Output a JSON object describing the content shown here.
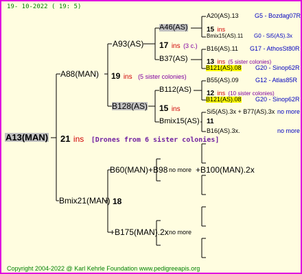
{
  "header": {
    "date": "19- 10-2022 ( 19: 5)"
  },
  "footer": {
    "copyright": "Copyright 2004-2022 @ Karl Kehrle Foundation    www.pedigreeapis.org"
  },
  "root": {
    "name": "A13(MAN)",
    "ins": "21",
    "ins_label": "ins",
    "note": "[Drones from 6 sister colonies]"
  },
  "gen1": {
    "top": {
      "name": "A88(MAN)",
      "ins": "19",
      "ins_label": "ins",
      "note": "(5 sister colonies)"
    },
    "bottom": {
      "name": "Bmix21(MAN)",
      "ins": "18"
    }
  },
  "gen2": {
    "a93": {
      "name": "A93(AS)",
      "ins": "17",
      "ins_label": "ins",
      "note": "(3 c.)"
    },
    "b128": {
      "name": "B128(AS)",
      "ins": "15",
      "ins_label": "ins"
    },
    "b60": {
      "name": "B60(MAN)+B98",
      "more": "no more"
    },
    "b175": {
      "name": "+B175(MAN).2x",
      "more": "no more"
    },
    "b100": {
      "name": "+B100(MAN).2x"
    }
  },
  "gen3": {
    "a46": {
      "name": "A46(AS)"
    },
    "b37": {
      "name": "B37(AS)"
    },
    "b112": {
      "name": "B112(AS)"
    },
    "bmix15": {
      "name": "Bmix15(AS)"
    }
  },
  "gen4": {
    "g1": {
      "name": "A20(AS).13",
      "loc": "G5 - Bozdag07R",
      "ins": "15",
      "ins_label": "ins",
      "extra": "Bmix15(AS).11",
      "extra_loc": "G0 - Si5(AS).3x"
    },
    "g2": {
      "name": "B16(AS).11",
      "loc": "G17 - AthosSt80R",
      "ins": "13",
      "ins_label": "ins",
      "note": "(5 sister colonies)",
      "extra": "B121(AS).08",
      "extra_loc": "G20 - Sinop62R"
    },
    "g3": {
      "name": "B55(AS).09",
      "loc": "G12 - Atlas85R",
      "ins": "12",
      "ins_label": "ins",
      "note": "(10 sister colonies)",
      "extra": "B121(AS).08",
      "extra_loc": "G20 - Sinop62R"
    },
    "g4": {
      "name": "Si5(AS).3x + B77(AS).3x",
      "more": "no more",
      "ins": "11",
      "extra": "B16(AS).3x.",
      "extra_more": "no more"
    }
  },
  "colors": {
    "border": "#e000e0",
    "background": "#fffde0",
    "lines": "#000000",
    "ins": "#d00000",
    "note": "#8000a0",
    "blue": "#0000c0",
    "highlight": "#ffff00",
    "grey": "#c0c0c0"
  }
}
